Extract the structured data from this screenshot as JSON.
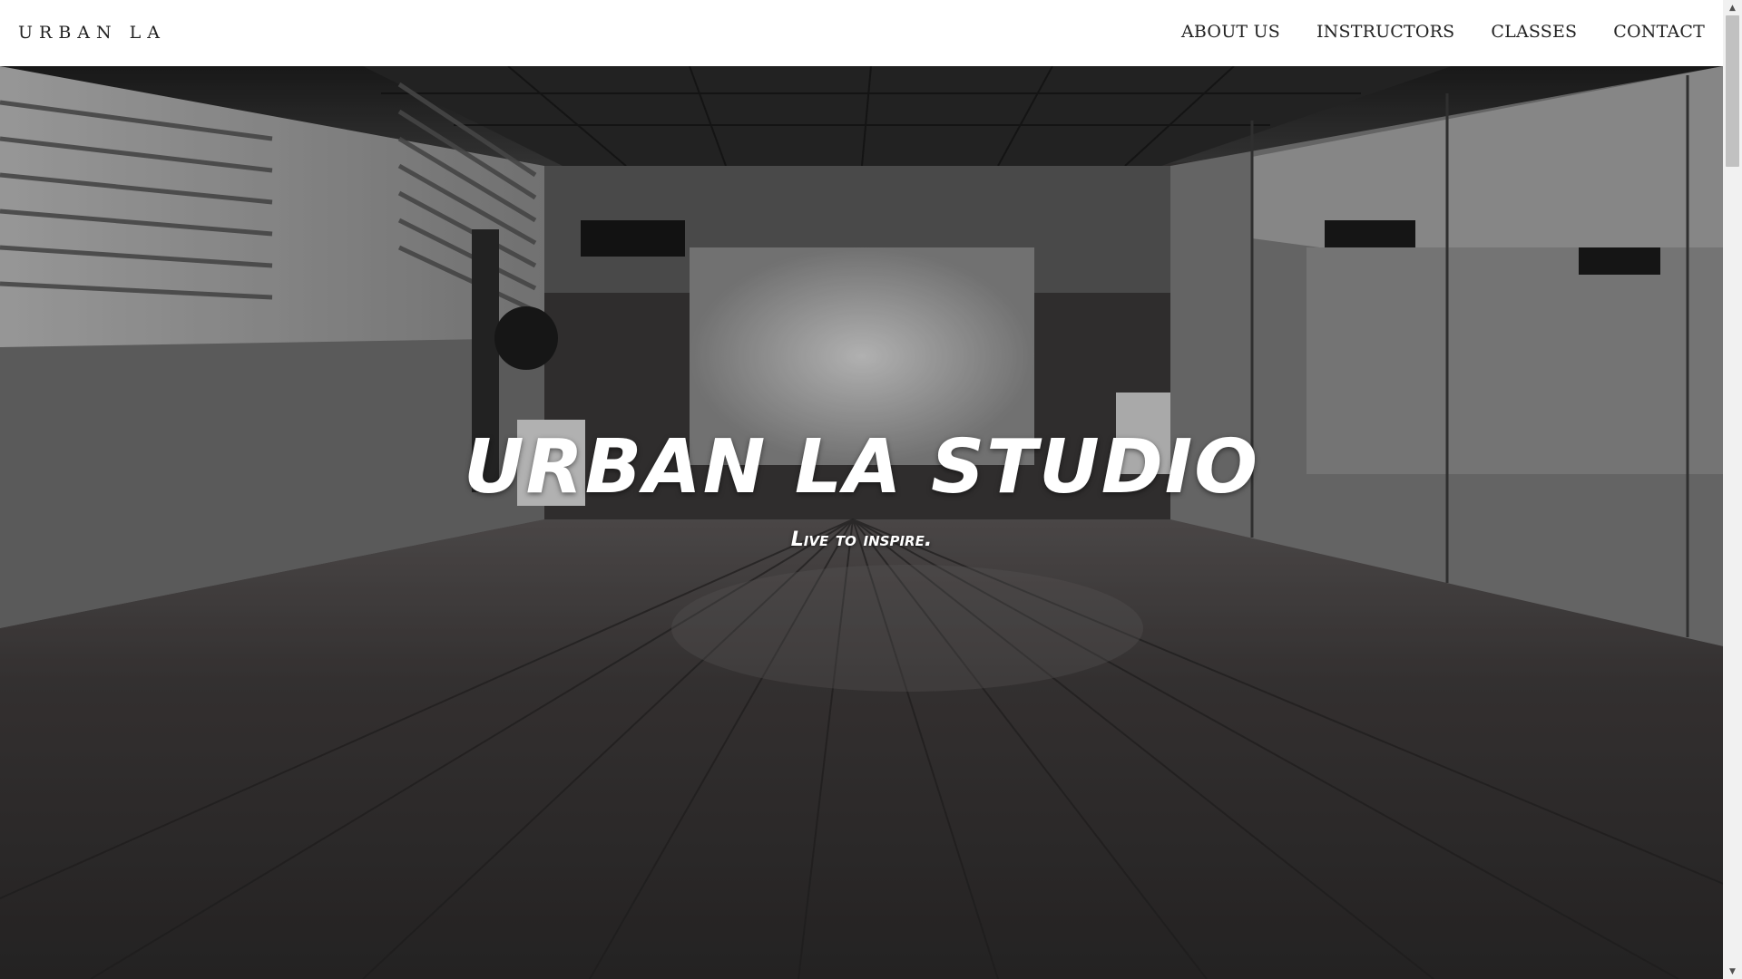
{
  "brand": "URBAN LA",
  "nav": [
    {
      "label": "ABOUT US"
    },
    {
      "label": "INSTRUCTORS"
    },
    {
      "label": "CLASSES"
    },
    {
      "label": "CONTACT"
    }
  ],
  "hero": {
    "title": "URBAN LA STUDIO",
    "subtitle": "Live to inspire."
  },
  "scrollbar": {
    "up_icon": "▲",
    "down_icon": "▼"
  }
}
